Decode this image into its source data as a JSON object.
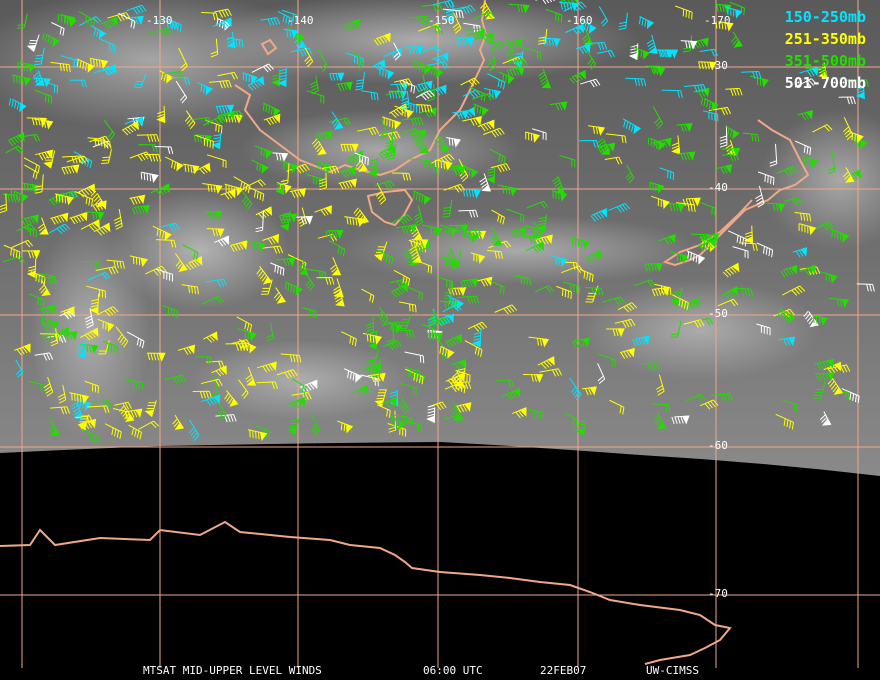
{
  "map": {
    "longitude_labels": [
      "-130",
      "-140",
      "-150",
      "-160",
      "-170"
    ],
    "latitude_labels": [
      "-30",
      "-40",
      "-50",
      "-60",
      "-70"
    ],
    "colors": {
      "grid": "#f0a888",
      "coastline": "#f0a888",
      "space": "#000000"
    }
  },
  "legend": [
    {
      "label": "150-250mb",
      "color": "#00e5ff"
    },
    {
      "label": "251-350mb",
      "color": "#ffff00"
    },
    {
      "label": "351-500mb",
      "color": "#22dd00"
    },
    {
      "label": "501-700mb",
      "color": "#ffffff"
    }
  ],
  "footer": {
    "product": "MTSAT MID-UPPER LEVEL WINDS",
    "time": "06:00 UTC",
    "date": "22FEB07",
    "source": "UW-CIMSS"
  }
}
